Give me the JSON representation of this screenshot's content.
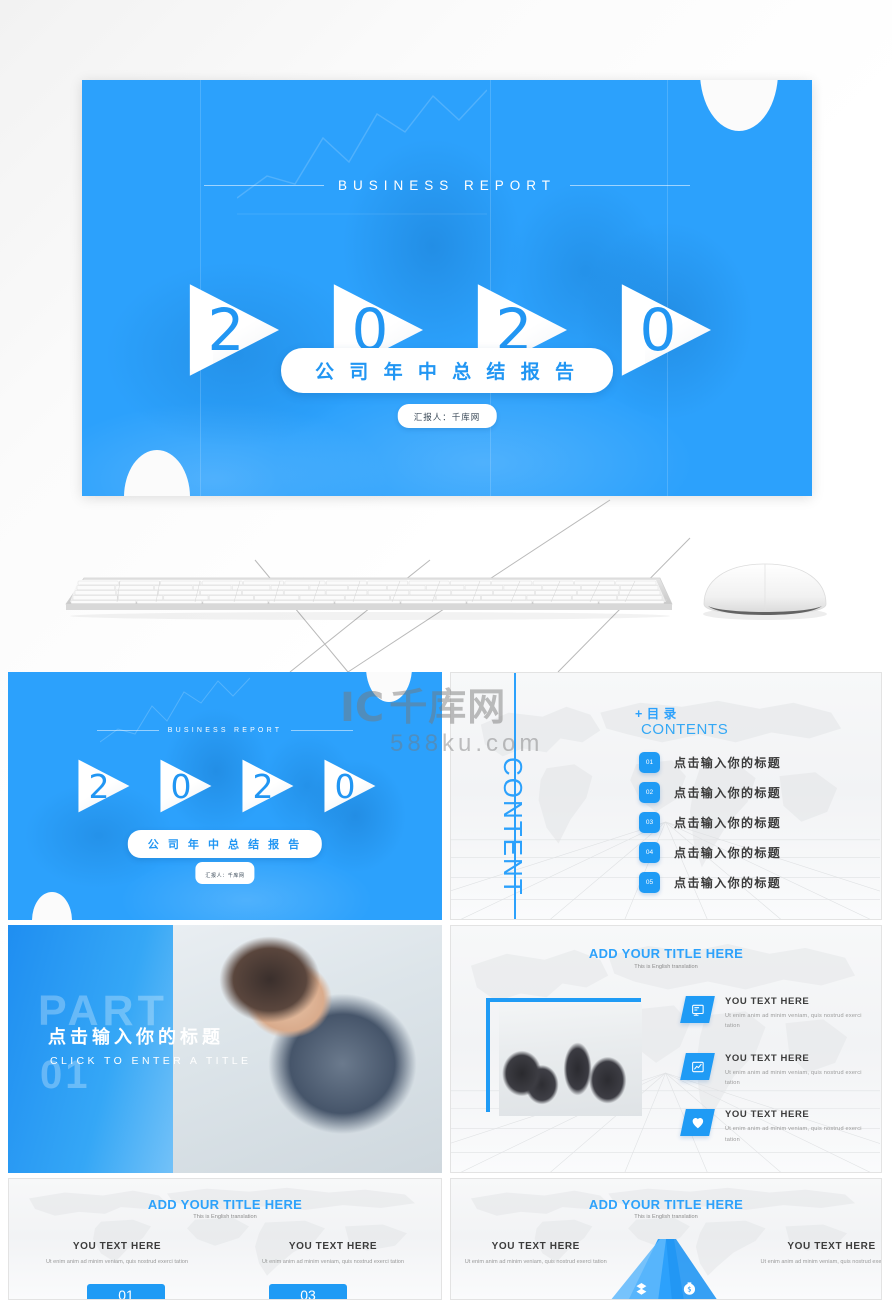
{
  "colors": {
    "brand_blue": "#2ca1fc",
    "accent_blue": "#1f9bf5",
    "title_blue": "#2da2fb",
    "body_gray": "#9a9a9a"
  },
  "hero": {
    "eyebrow": "BUSINESS REPORT",
    "year_digits": [
      "2",
      "0",
      "2",
      "0"
    ],
    "title": "公 司 年 中 总 结 报 告",
    "author": "汇报人：千库网"
  },
  "devices": {
    "keyboard_label": "keyboard",
    "mouse_label": "mouse"
  },
  "slides": {
    "title_thumb": {
      "eyebrow": "BUSINESS REPORT",
      "year_digits": [
        "2",
        "0",
        "2",
        "0"
      ],
      "title": "公 司 年 中 总 结 报 告",
      "author": "汇报人：千库网"
    },
    "contents": {
      "vertical_label": "CONTENT",
      "heading_cn": "+ 目 录",
      "heading_en": "CONTENTS",
      "items": [
        {
          "num": "01",
          "label": "点击输入你的标题"
        },
        {
          "num": "02",
          "label": "点击输入你的标题"
        },
        {
          "num": "03",
          "label": "点击输入你的标题"
        },
        {
          "num": "04",
          "label": "点击输入你的标题"
        },
        {
          "num": "05",
          "label": "点击输入你的标题"
        }
      ]
    },
    "part": {
      "ghost_word": "PART",
      "ghost_num": "01",
      "title": "点击输入你的标题",
      "subtitle": "CLICK TO ENTER A TITLE"
    },
    "features": {
      "title": "ADD YOUR TITLE HERE",
      "subtitle": "This is English translation",
      "items": [
        {
          "icon": "document-icon",
          "heading": "YOU TEXT HERE",
          "body": "Ut enim anim ad minim veniam, quis nostrud exerci tation"
        },
        {
          "icon": "chart-icon",
          "heading": "YOU TEXT HERE",
          "body": "Ut enim anim ad minim veniam, quis nostrud exerci tation"
        },
        {
          "icon": "heart-icon",
          "heading": "YOU TEXT HERE",
          "body": "Ut enim anim ad minim veniam, quis nostrud exerci tation"
        }
      ]
    },
    "two_col_left": {
      "title": "ADD YOUR TITLE HERE",
      "subtitle": "This is English translation",
      "columns": [
        {
          "num": "01",
          "heading": "YOU TEXT HERE",
          "body": "Ut enim anim ad minim veniam, quis nostrud exerci tation"
        },
        {
          "num": "03",
          "heading": "YOU TEXT HERE",
          "body": "Ut enim anim ad minim veniam, quis nostrud exerci tation"
        }
      ]
    },
    "two_col_right": {
      "title": "ADD YOUR TITLE HERE",
      "subtitle": "This is English translation",
      "columns": [
        {
          "heading": "YOU TEXT HERE",
          "body": "Ut enim anim ad minim veniam, quis nostrud exerci tation"
        },
        {
          "heading": "YOU TEXT HERE",
          "body": "Ut enim anim ad minim veniam, quis nostrud exerci tation"
        }
      ]
    }
  },
  "watermark": {
    "logo": "IC",
    "brand_cn": "千库网",
    "url": "588ku.com"
  }
}
